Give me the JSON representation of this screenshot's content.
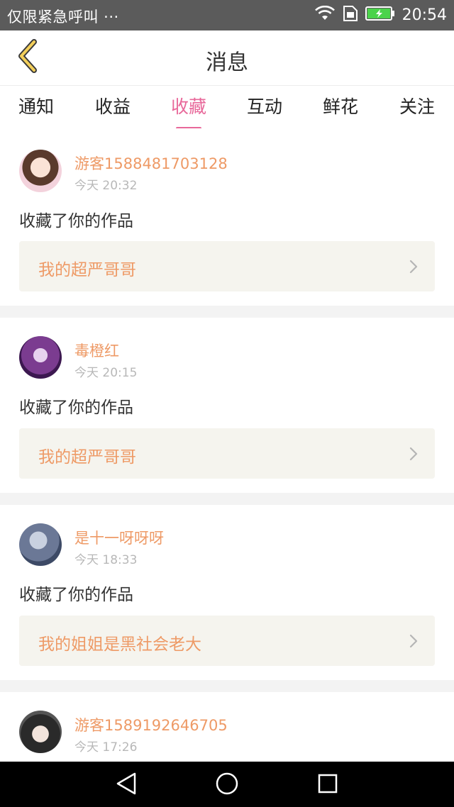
{
  "status_bar": {
    "carrier": "仅限紧急呼叫 ···",
    "time": "20:54"
  },
  "header": {
    "title": "消息"
  },
  "tabs": [
    {
      "label": "通知",
      "active": false
    },
    {
      "label": "收益",
      "active": false
    },
    {
      "label": "收藏",
      "active": true
    },
    {
      "label": "互动",
      "active": false
    },
    {
      "label": "鲜花",
      "active": false
    },
    {
      "label": "关注",
      "active": false
    }
  ],
  "messages": [
    {
      "username": "游客1588481703128",
      "time": "今天 20:32",
      "action": "收藏了你的作品",
      "work_title": "我的超严哥哥"
    },
    {
      "username": "毒橙红",
      "time": "今天 20:15",
      "action": "收藏了你的作品",
      "work_title": "我的超严哥哥"
    },
    {
      "username": "是十一呀呀呀",
      "time": "今天 18:33",
      "action": "收藏了你的作品",
      "work_title": "我的姐姐是黑社会老大"
    },
    {
      "username": "游客1589192646705",
      "time": "今天 17:26"
    }
  ],
  "colors": {
    "accent": "#e8689a",
    "username": "#ee9a66",
    "work_box": "#f5f4ee",
    "status_bar": "#5b5b5b",
    "battery": "#4bd34b"
  }
}
